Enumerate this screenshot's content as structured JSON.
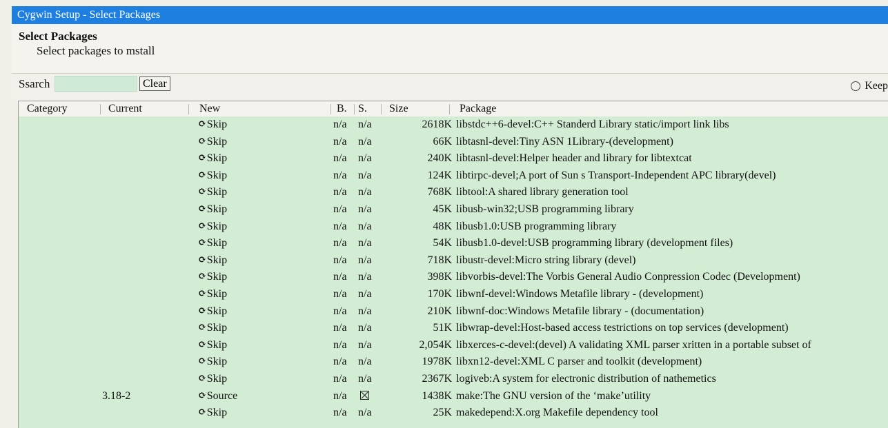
{
  "window": {
    "title": "Cygwin Setup - Select Packages"
  },
  "header": {
    "title": "Select Packages",
    "subtitle": "Select packages to mstall"
  },
  "search": {
    "label": "Ssarch",
    "value": "",
    "clear_label": "Clear"
  },
  "view_options": {
    "keep_label": "Keep"
  },
  "columns": {
    "category": "Category",
    "current": "Current",
    "new": "New",
    "bin": "B.",
    "src": "S.",
    "size": "Size",
    "package": "Package"
  },
  "rows": [
    {
      "current": "",
      "new": "Skip",
      "bin": "n/a",
      "src": "n/a",
      "size": "2618K",
      "package": "libstdc++6-devel:C++ Standerd Library static/import link libs"
    },
    {
      "current": "",
      "new": "Skip",
      "bin": "n/a",
      "src": "n/a",
      "size": "66K",
      "package": "libtasnl-devel:Tiny ASN 1Library-(development)"
    },
    {
      "current": "",
      "new": "Skip",
      "bin": "n/a",
      "src": "n/a",
      "size": "240K",
      "package": "libtasnl-devel:Helper header and library for libtextcat"
    },
    {
      "current": "",
      "new": "Skip",
      "bin": "n/a",
      "src": "n/a",
      "size": "124K",
      "package": "libtirpc-devel;A port of Sun s Transport-Independent APC library(devel)"
    },
    {
      "current": "",
      "new": "Skip",
      "bin": "n/a",
      "src": "n/a",
      "size": "768K",
      "package": "libtool:A shared library generation tool"
    },
    {
      "current": "",
      "new": "Skip",
      "bin": "n/a",
      "src": "n/a",
      "size": "45K",
      "package": "libusb-win32;USB programming library"
    },
    {
      "current": "",
      "new": "Skip",
      "bin": "n/a",
      "src": "n/a",
      "size": "48K",
      "package": "libusb1.0:USB programming library"
    },
    {
      "current": "",
      "new": "Skip",
      "bin": "n/a",
      "src": "n/a",
      "size": "54K",
      "package": "libusb1.0-devel:USB programming library (development files)"
    },
    {
      "current": "",
      "new": "Skip",
      "bin": "n/a",
      "src": "n/a",
      "size": "718K",
      "package": "libustr-devel:Micro string library (devel)"
    },
    {
      "current": "",
      "new": "Skip",
      "bin": "n/a",
      "src": "n/a",
      "size": "398K",
      "package": "libvorbis-devel:The Vorbis General Audio Conpression Codec (Development)"
    },
    {
      "current": "",
      "new": "Skip",
      "bin": "n/a",
      "src": "n/a",
      "size": "170K",
      "package": "libwnf-devel:Windows Metafile library - (development)"
    },
    {
      "current": "",
      "new": "Skip",
      "bin": "n/a",
      "src": "n/a",
      "size": "210K",
      "package": "libwnf-doc:Windows Metafile library - (documentation)"
    },
    {
      "current": "",
      "new": "Skip",
      "bin": "n/a",
      "src": "n/a",
      "size": "51K",
      "package": "libwrap-devel:Host-based access testrictions on top services (development)"
    },
    {
      "current": "",
      "new": "Skip",
      "bin": "n/a",
      "src": "n/a",
      "size": "2,054K",
      "package": "libxerces-c-devel:(devel) A validating XML parser xritten in a portable subset of"
    },
    {
      "current": "",
      "new": "Skip",
      "bin": "n/a",
      "src": "n/a",
      "size": "1978K",
      "package": "libxn12-devel:XML C parser and toolkit (development)"
    },
    {
      "current": "",
      "new": "Skip",
      "bin": "n/a",
      "src": "n/a",
      "size": "2367K",
      "package": "logiveb:A system for electronic distribution of nathemetics"
    },
    {
      "current": "3.18-2",
      "new": "Source",
      "bin": "n/a",
      "src": "checked",
      "size": "1438K",
      "package": "make:The GNU version of the ‘make’utility"
    },
    {
      "current": "",
      "new": "Skip",
      "bin": "n/a",
      "src": "n/a",
      "size": "25K",
      "package": "makedepend:X.org Makefile dependency tool"
    }
  ],
  "icons": {
    "new_action": "cycle-icon",
    "src_checked": "checkbox-checked-icon"
  },
  "colors": {
    "titlebar": "#1f7fe0",
    "row_background": "#d3ecd4",
    "search_field": "#cfead6"
  }
}
